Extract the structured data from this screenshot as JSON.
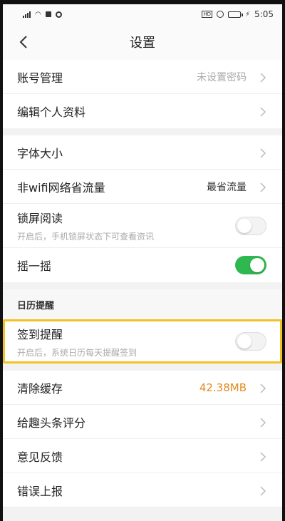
{
  "status_bar": {
    "time": "5:05"
  },
  "nav": {
    "title": "设置"
  },
  "group1": [
    {
      "label": "账号管理",
      "value": "未设置密码"
    },
    {
      "label": "编辑个人资料",
      "value": ""
    }
  ],
  "group2": {
    "font_size": {
      "label": "字体大小"
    },
    "non_wifi": {
      "label": "非wifi网络省流量",
      "value": "最省流量"
    },
    "lock_read": {
      "label": "锁屏阅读",
      "sub": "开启后，手机锁屏状态下可查看资讯",
      "enabled": false
    },
    "shake": {
      "label": "摇一摇",
      "enabled": true
    }
  },
  "calendar": {
    "header": "日历提醒",
    "sign_in": {
      "label": "签到提醒",
      "sub": "开启后，系统日历每天提醒签到",
      "enabled": false
    }
  },
  "group3": {
    "clear_cache": {
      "label": "清除缓存",
      "value": "42.38MB"
    },
    "rate": {
      "label": "给趣头条评分"
    },
    "feedback": {
      "label": "意见反馈"
    },
    "report": {
      "label": "错误上报"
    }
  },
  "colors": {
    "toggle_on": "#2eb84f",
    "cache_value": "#e58a1f",
    "highlight": "#f2c122"
  }
}
